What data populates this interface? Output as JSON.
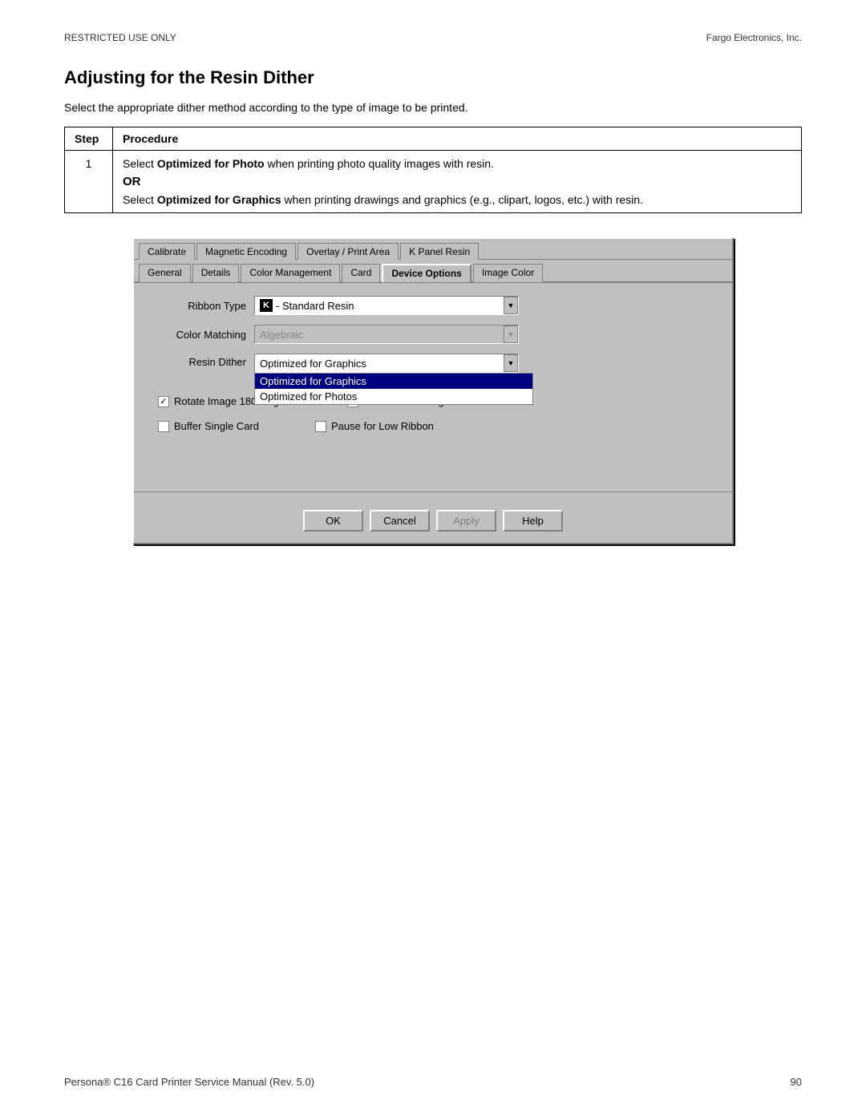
{
  "header": {
    "left": "RESTRICTED USE ONLY",
    "right": "Fargo Electronics, Inc."
  },
  "page_title": "Adjusting for the Resin Dither",
  "intro": "Select the appropriate dither method according to the type of image to be printed.",
  "table": {
    "col1": "Step",
    "col2": "Procedure",
    "row1_step": "1",
    "row1_text1": "Select ",
    "row1_bold1": "Optimized for Photo",
    "row1_text2": " when printing photo quality images with resin.",
    "row1_or": "OR",
    "row1_text3": "Select ",
    "row1_bold2": "Optimized for Graphics",
    "row1_text4": " when printing drawings and graphics (e.g., clipart, logos, etc.) with resin."
  },
  "dialog": {
    "tabs_top": [
      "Calibrate",
      "Magnetic Encoding",
      "Overlay / Print Area",
      "K Panel Resin"
    ],
    "tabs_bottom": [
      "General",
      "Details",
      "Color Management",
      "Card",
      "Device Options",
      "Image Color"
    ],
    "active_tab": "Device Options",
    "ribbon_type_label": "Ribbon Type",
    "ribbon_type_value": "K - Standard Resin",
    "color_matching_label": "Color Matching",
    "color_matching_value": "Algebraic",
    "resin_dither_label": "Resin Dither",
    "resin_dither_value": "Optimized for Graphics",
    "dropdown_options": [
      "Optimized for Graphics",
      "Optimized for Photos"
    ],
    "selected_option": "Optimized for Graphics",
    "checkbox_rotate": "Rotate Image 180 Degrees",
    "checkbox_rotate_checked": true,
    "checkbox_buffer": "Buffer Single Card",
    "checkbox_buffer_checked": false,
    "checkbox_disable": "Disable Printing",
    "checkbox_disable_checked": false,
    "checkbox_pause": "Pause for Low Ribbon",
    "checkbox_pause_checked": false,
    "btn_ok": "OK",
    "btn_cancel": "Cancel",
    "btn_apply": "Apply",
    "btn_help": "Help"
  },
  "footer": {
    "left": "Persona® C16 Card Printer Service Manual (Rev. 5.0)",
    "right": "90"
  }
}
